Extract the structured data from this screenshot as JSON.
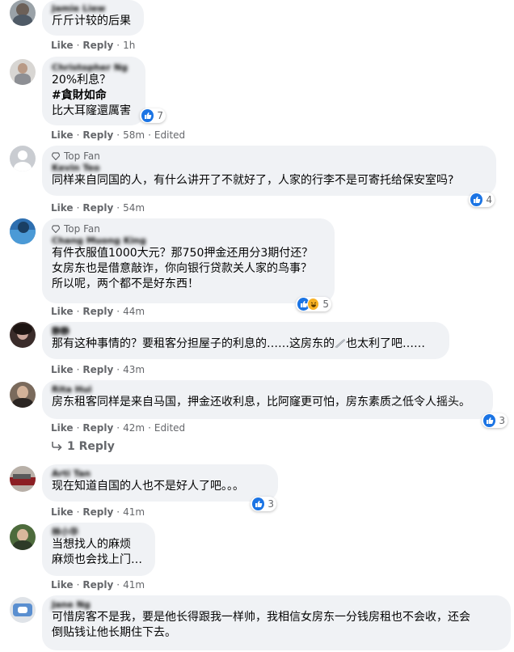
{
  "actions": {
    "like": "Like",
    "reply": "Reply",
    "sep": "·",
    "edited": "Edited"
  },
  "comments": [
    {
      "author": "Jamie Liew",
      "lines": [
        "斤斤计较的后果"
      ],
      "time": "1h"
    },
    {
      "author": "Christopher Ng",
      "line1": "20%利息？",
      "hashtag": "#貪財如命",
      "line3": "比大耳窿還厲害",
      "time": "58m",
      "reactions": "7"
    },
    {
      "badge": "Top Fan",
      "author": "Kevin Teo",
      "lines": [
        "同样来自同国的人，有什么讲开了不就好了，人家的行李不是可寄托给保安室吗?"
      ],
      "time": "54m",
      "reactions": "4"
    },
    {
      "badge": "Top Fan",
      "author": "Chang Muong King",
      "lines": [
        "有件衣服值1000大元？那750押金还用分3期付还？",
        "女房东也是借意敲诈，你向银行贷款关人家的鸟事？",
        "所以呢，两个都不是好东西！"
      ],
      "time": "44m",
      "reactions": "5"
    },
    {
      "author": "静静",
      "lines": [
        "那有这种事情的？要租客分担屋子的利息的……这房东的",
        "也太利了吧……"
      ],
      "time": "43m"
    },
    {
      "author": "Rita Hui",
      "lines": [
        "房东租客同样是来自马国，押金还收利息，比阿窿更可怕，房东素质之低令人摇头。"
      ],
      "time": "42m",
      "reactions": "3",
      "replies": "1 Reply"
    },
    {
      "author": "Arti Tan",
      "lines": [
        "现在知道自国的人也不是好人了吧。。。"
      ],
      "time": "41m",
      "reactions": "3"
    },
    {
      "author": "林小华",
      "lines": [
        "当想找人的麻烦",
        "麻烦也会找上门…"
      ],
      "time": "41m"
    },
    {
      "author": "Jane Ng",
      "lines": [
        "可惜房客不是我，要是他长得跟我一样帅，我相信女房东一分钱房租也不会收，还会",
        "倒贴钱让他长期住下去。"
      ]
    }
  ],
  "colors": {
    "bubble": "#f0f2f5",
    "like_blue": "#1b74e4",
    "meta_gray": "#65676b",
    "haha": "#f7b125"
  },
  "icons": [
    "thumbs-up-icon",
    "haha-icon",
    "top-fan-gem-icon",
    "reply-arrow-icon"
  ]
}
